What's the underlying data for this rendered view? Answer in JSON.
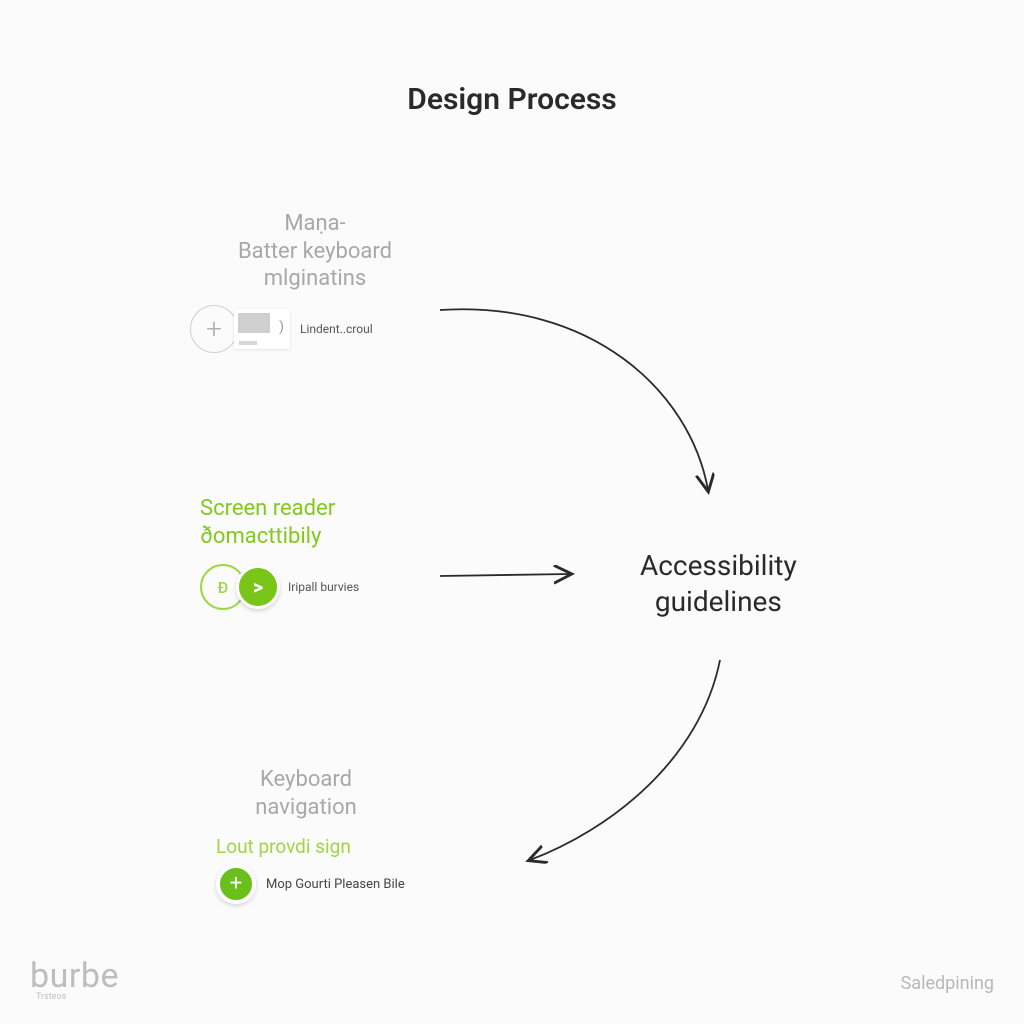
{
  "title": "Design Process",
  "nodes": {
    "n1": {
      "line1": "Maṇa-",
      "line2": "Βatter keyboard",
      "line3": "mlginatins",
      "tag": "Lindent..croul"
    },
    "n2": {
      "line1": "Screen reader",
      "line2": "ðomacttibily",
      "tag": "Iripall burvies",
      "ring_glyph": "Ð"
    },
    "n3": {
      "line1": "Keyboard",
      "line2": "navigation",
      "subtitle": "Lout provdi sign",
      "desc": "Mop Gourti Pleasen Bile"
    }
  },
  "target": {
    "line1": "Accessibility",
    "line2": "guidelines"
  },
  "footer": {
    "brand": "burbe",
    "brand_sub": "Trsteos",
    "right": "Saledpining"
  },
  "colors": {
    "accent": "#7ac519",
    "muted": "#a8a8a8"
  }
}
